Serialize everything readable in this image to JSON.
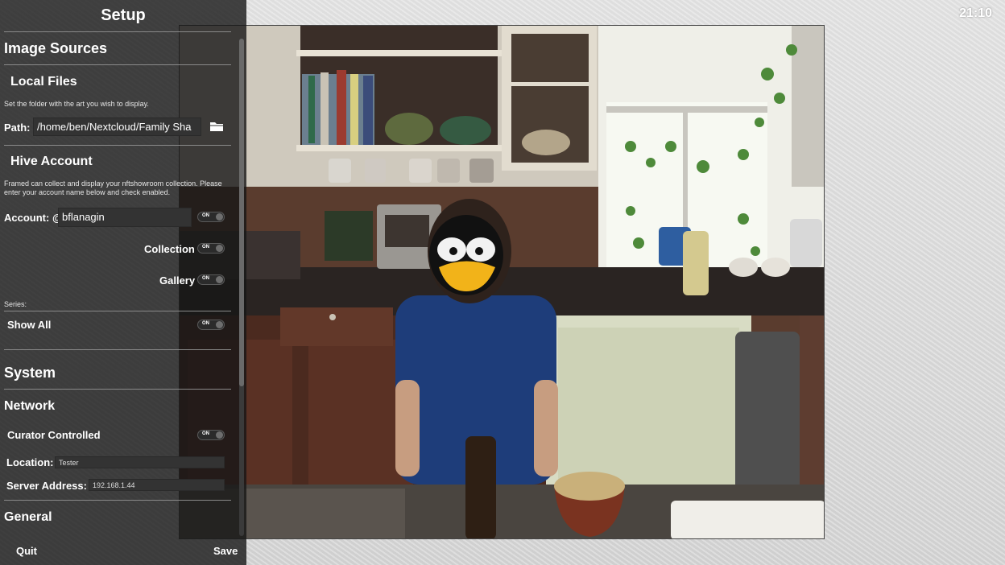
{
  "clock": "21:10",
  "panel": {
    "title": "Setup",
    "image_sources": "Image Sources",
    "local_files": {
      "heading": "Local Files",
      "desc": "Set the folder with the art you wish to display.",
      "path_label": "Path:",
      "path_value": "/home/ben/Nextcloud/Family Sha",
      "browse_icon": "folder-icon"
    },
    "hive": {
      "heading": "Hive Account",
      "desc_line1": "Framed can collect and display your nftshowroom collection. Please",
      "desc_line2": "enter your account name below and check enabled.",
      "account_label": "Account: @",
      "account_value": "bflanagin",
      "account_toggle": "ON",
      "collection_label": "Collection",
      "collection_toggle": "ON",
      "gallery_label": "Gallery",
      "gallery_toggle": "ON",
      "series_label": "Series:",
      "show_all_label": "Show All",
      "show_all_toggle": "ON"
    },
    "system": "System",
    "network": {
      "heading": "Network",
      "curator_label": "Curator Controlled",
      "curator_toggle": "ON",
      "location_label": "Location:",
      "location_value": "Tester",
      "server_label": "Server Address:",
      "server_value": "192.168.1.44"
    },
    "general": "General",
    "quit": "Quit",
    "save": "Save"
  }
}
